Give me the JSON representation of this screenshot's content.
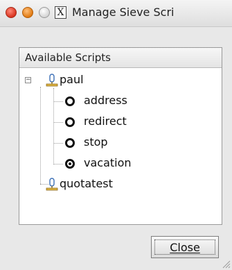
{
  "window": {
    "title": "Manage Sieve Scri",
    "app_icon_glyph": "X"
  },
  "panel": {
    "header": "Available Scripts"
  },
  "tree": {
    "accounts": [
      {
        "name": "paul",
        "expanded": true,
        "scripts": [
          {
            "name": "address",
            "active": false
          },
          {
            "name": "redirect",
            "active": false
          },
          {
            "name": "stop",
            "active": false
          },
          {
            "name": "vacation",
            "active": true
          }
        ]
      },
      {
        "name": "quotatest",
        "expanded": false
      }
    ]
  },
  "buttons": {
    "close_label": "Close"
  },
  "colors": {
    "close_button": "#d8331f",
    "minimize_button": "#e07a12",
    "window_bg": "#e8e8e8"
  },
  "icons": {
    "expander": "minus-expander-icon",
    "account": "user-account-icon"
  }
}
